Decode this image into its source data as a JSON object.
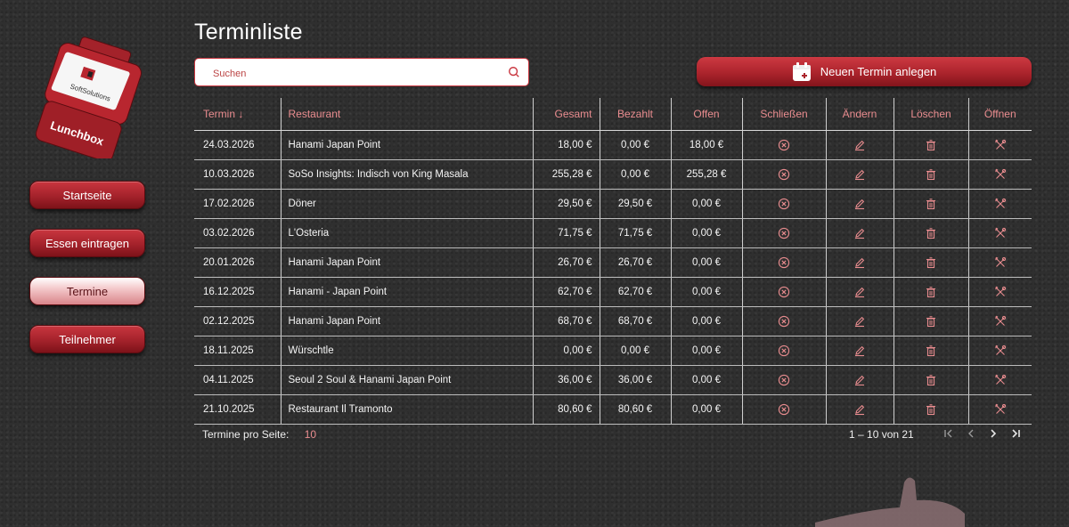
{
  "logo": {
    "brand": "SoftSolutions",
    "name": "Lunchbox"
  },
  "nav": [
    {
      "label": "Startseite"
    },
    {
      "label": "Essen eintragen"
    },
    {
      "label": "Termine"
    },
    {
      "label": "Teilnehmer"
    }
  ],
  "page": {
    "title": "Terminliste"
  },
  "search": {
    "placeholder": "Suchen"
  },
  "new_button": {
    "label": "Neuen Termin anlegen"
  },
  "table": {
    "headers": {
      "termin": "Termin ↓",
      "restaurant": "Restaurant",
      "gesamt": "Gesamt",
      "bezahlt": "Bezahlt",
      "offen": "Offen",
      "schliessen": "Schließen",
      "aendern": "Ändern",
      "loeschen": "Löschen",
      "oeffnen": "Öffnen"
    },
    "rows": [
      {
        "termin": "24.03.2026",
        "restaurant": "Hanami Japan Point",
        "gesamt": "18,00 €",
        "bezahlt": "0,00 €",
        "offen": "18,00 €"
      },
      {
        "termin": "10.03.2026",
        "restaurant": "SoSo Insights: Indisch von King Masala",
        "gesamt": "255,28 €",
        "bezahlt": "0,00 €",
        "offen": "255,28 €"
      },
      {
        "termin": "17.02.2026",
        "restaurant": "Döner",
        "gesamt": "29,50 €",
        "bezahlt": "29,50 €",
        "offen": "0,00 €"
      },
      {
        "termin": "03.02.2026",
        "restaurant": "L'Osteria",
        "gesamt": "71,75 €",
        "bezahlt": "71,75 €",
        "offen": "0,00 €"
      },
      {
        "termin": "20.01.2026",
        "restaurant": "Hanami Japan Point",
        "gesamt": "26,70 €",
        "bezahlt": "26,70 €",
        "offen": "0,00 €"
      },
      {
        "termin": "16.12.2025",
        "restaurant": "Hanami - Japan Point",
        "gesamt": "62,70 €",
        "bezahlt": "62,70 €",
        "offen": "0,00 €"
      },
      {
        "termin": "02.12.2025",
        "restaurant": "Hanami Japan Point",
        "gesamt": "68,70 €",
        "bezahlt": "68,70 €",
        "offen": "0,00 €"
      },
      {
        "termin": "18.11.2025",
        "restaurant": "Würschtle",
        "gesamt": "0,00 €",
        "bezahlt": "0,00 €",
        "offen": "0,00 €"
      },
      {
        "termin": "04.11.2025",
        "restaurant": "Seoul 2 Soul & Hanami Japan Point",
        "gesamt": "36,00 €",
        "bezahlt": "36,00 €",
        "offen": "0,00 €"
      },
      {
        "termin": "21.10.2025",
        "restaurant": "Restaurant Il Tramonto",
        "gesamt": "80,60 €",
        "bezahlt": "80,60 €",
        "offen": "0,00 €"
      }
    ]
  },
  "paging": {
    "per_page_label": "Termine pro Seite:",
    "per_page_value": "10",
    "range": "1 – 10 von 21"
  },
  "colors": {
    "accent": "#e98c8f",
    "button": "#ab242c",
    "background": "#2f2f2f"
  }
}
